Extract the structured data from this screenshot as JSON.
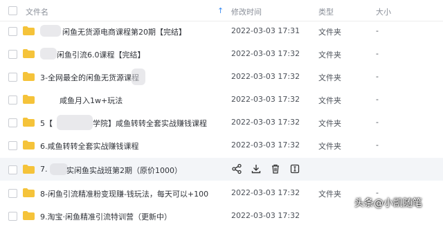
{
  "header": {
    "name_label": "文件名",
    "time_label": "修改时间",
    "type_label": "类型",
    "size_label": "大小"
  },
  "rows": [
    {
      "name": "闲鱼无货源电商课程第20期【完结】",
      "time": "2022-03-03 17:31",
      "type": "文件夹",
      "size": "-"
    },
    {
      "name": "闲鱼引流6.0课程【完结】",
      "time": "2022-03-03 17:32",
      "type": "文件夹",
      "size": "-"
    },
    {
      "name": "3-全网最全的闲鱼无货源课程",
      "time": "2022-03-03 17:32",
      "type": "文件夹",
      "size": "-"
    },
    {
      "name": "咸鱼月入1w+玩法",
      "time": "2022-03-03 17:32",
      "type": "文件夹",
      "size": "-"
    },
    {
      "name": "5【",
      "name_suffix": "学院】咸鱼转转全套实战赚钱课程",
      "time": "2022-03-03 17:32",
      "type": "文件夹",
      "size": "-"
    },
    {
      "name": "6.咸鱼转转全套实战赚钱课程",
      "time": "2022-03-03 17:32",
      "type": "文件夹",
      "size": "-"
    },
    {
      "name": "7.",
      "name_suffix": "实闲鱼实战班第2期（原价1000）",
      "time": "",
      "type": "",
      "size": ""
    },
    {
      "name": "8-闲鱼引流精准粉变现赚-钱玩法，每天可以+100",
      "time": "2022-03-03 17:32",
      "type": "文件夹",
      "size": "-"
    },
    {
      "name": "9.淘宝·闲鱼精准引流特训营（更新中）",
      "time": "2022-03-03 17:32",
      "type": "",
      "size": ""
    }
  ],
  "watermark": "头条@小凯随笔",
  "colors": {
    "accent": "#3a8bf2",
    "folder": "#f5c33a",
    "hover": "#f3f5f8"
  }
}
